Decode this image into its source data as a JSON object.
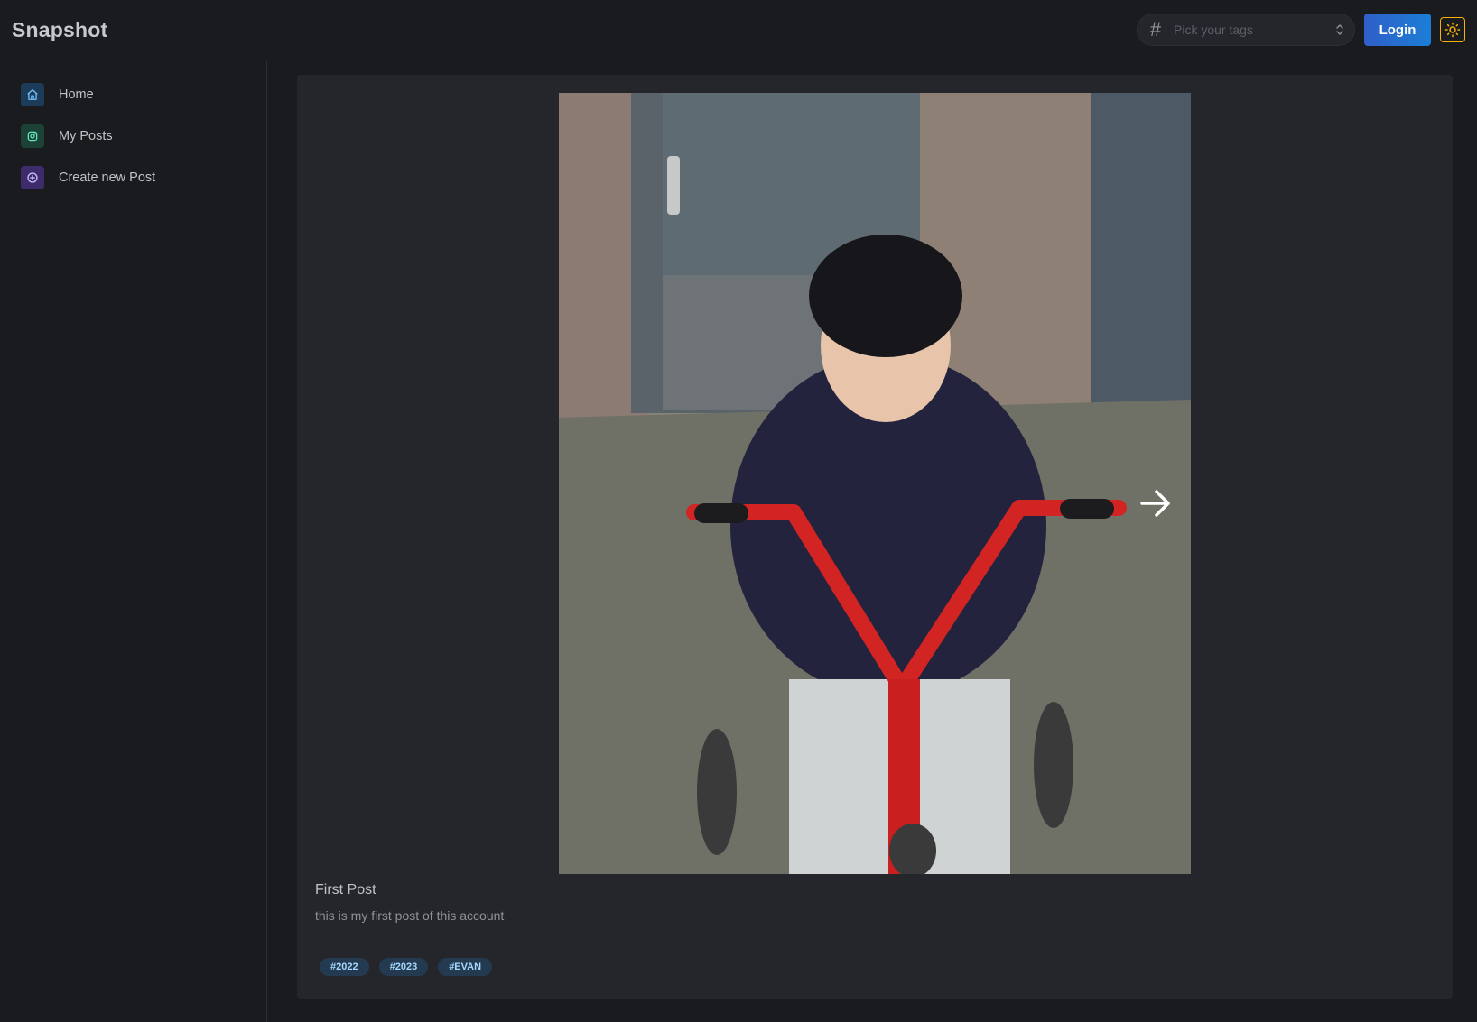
{
  "app": {
    "title": "Snapshot"
  },
  "header": {
    "tags_placeholder": "Pick your tags",
    "login_label": "Login"
  },
  "sidebar": {
    "items": [
      {
        "label": "Home",
        "icon": "home-icon",
        "color": "#74c0fc",
        "bg": "#1c3c5a"
      },
      {
        "label": "My Posts",
        "icon": "instagram-icon",
        "color": "#63e6be",
        "bg": "#1b4235"
      },
      {
        "label": "Create new Post",
        "icon": "plus-circle-icon",
        "color": "#d0bfff",
        "bg": "#3e2b6b"
      }
    ]
  },
  "post": {
    "title": "First Post",
    "description": "this is my first post of this account",
    "tags": [
      "#2022",
      "#2023",
      "#EVAN"
    ]
  },
  "colors": {
    "background": "#1a1b1e",
    "card": "#25262b",
    "accent": "#1c7ed6",
    "theme_toggle": "#fab005"
  }
}
